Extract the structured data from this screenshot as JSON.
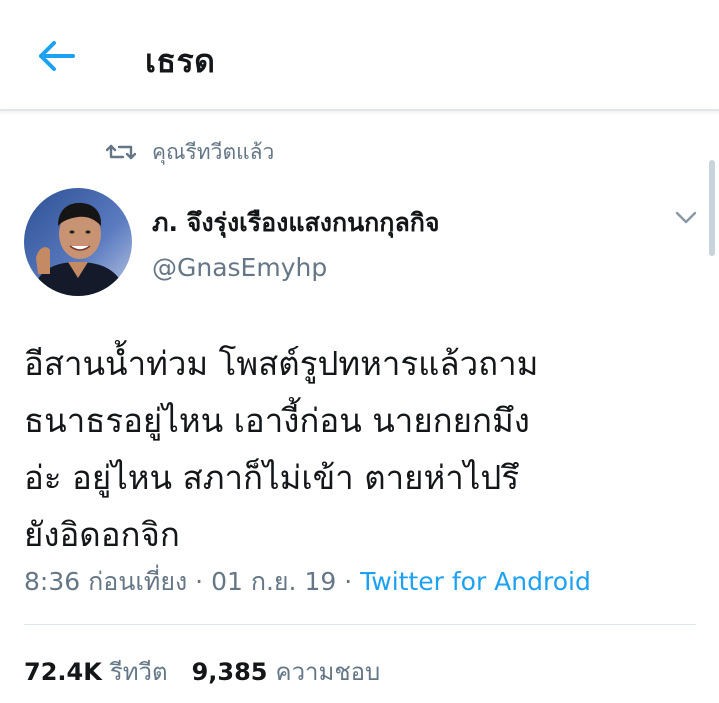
{
  "header": {
    "title": "เธรด",
    "back_icon": "arrow-left-icon",
    "accent": "#1da1f2"
  },
  "retweet_context": {
    "icon": "retweet-icon",
    "label": "คุณรีทวีตแล้ว"
  },
  "author": {
    "display_name": "ภ. จึงรุ่งเรืองแสงกนกกุลกิจ",
    "handle": "@GnasEmyhp"
  },
  "tweet": {
    "text": "อีสานน้ำท่วม โพสต์รูปทหารแล้วถาม\nธนาธรอยู่ไหน เอางี้ก่อน นายกยกมึง\nอ่ะ อยู่ไหน สภาก็ไม่เข้า ตายห่าไปรึ\nยังอิดอกจิก",
    "time": "8:36 ก่อนเที่ยง",
    "separator": " · ",
    "date": "01 ก.ย. 19",
    "client": "Twitter for Android"
  },
  "stats": {
    "retweets_count": "72.4K",
    "retweets_label": "รีทวีต",
    "likes_count": "9,385",
    "likes_label": "ความชอบ"
  },
  "colors": {
    "secondary_text": "#657786",
    "primary_text": "#14171a",
    "link": "#1da1f2"
  }
}
